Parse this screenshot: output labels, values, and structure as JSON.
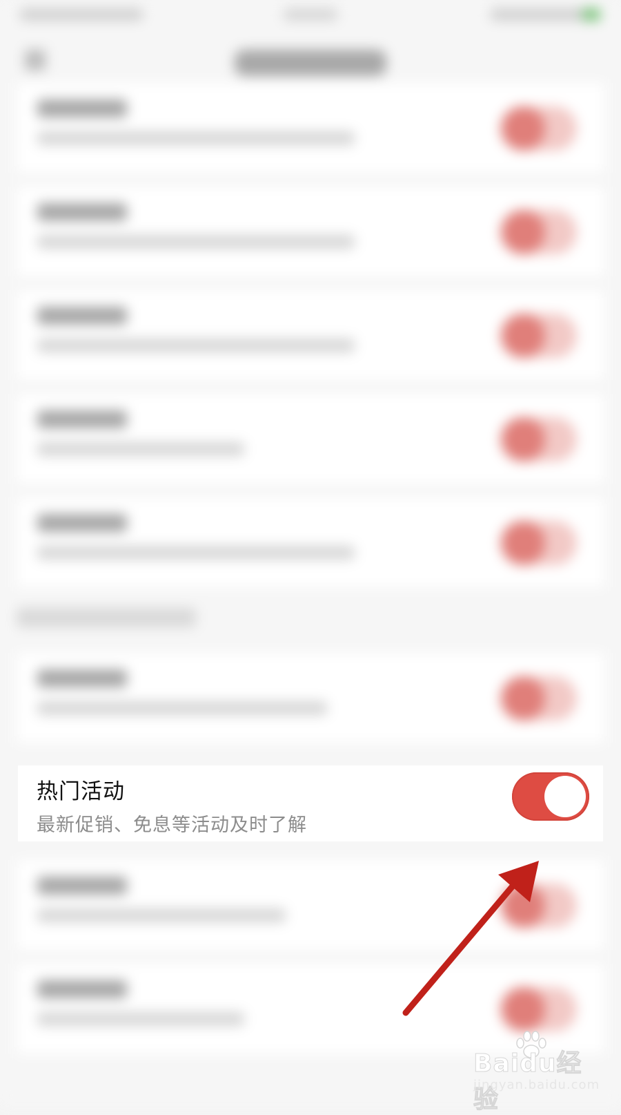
{
  "setting": {
    "title": "热门活动",
    "description": "最新促销、免息等活动及时了解",
    "toggle_on": true
  },
  "colors": {
    "accent": "#de4c43",
    "arrow": "#c0211a",
    "background": "#f5f5f5"
  },
  "watermark": {
    "brand": "Baidu经验",
    "url": "jingyan.baidu.com"
  },
  "icons": [
    "arrow-annotation-icon",
    "baidu-paw-icon"
  ]
}
